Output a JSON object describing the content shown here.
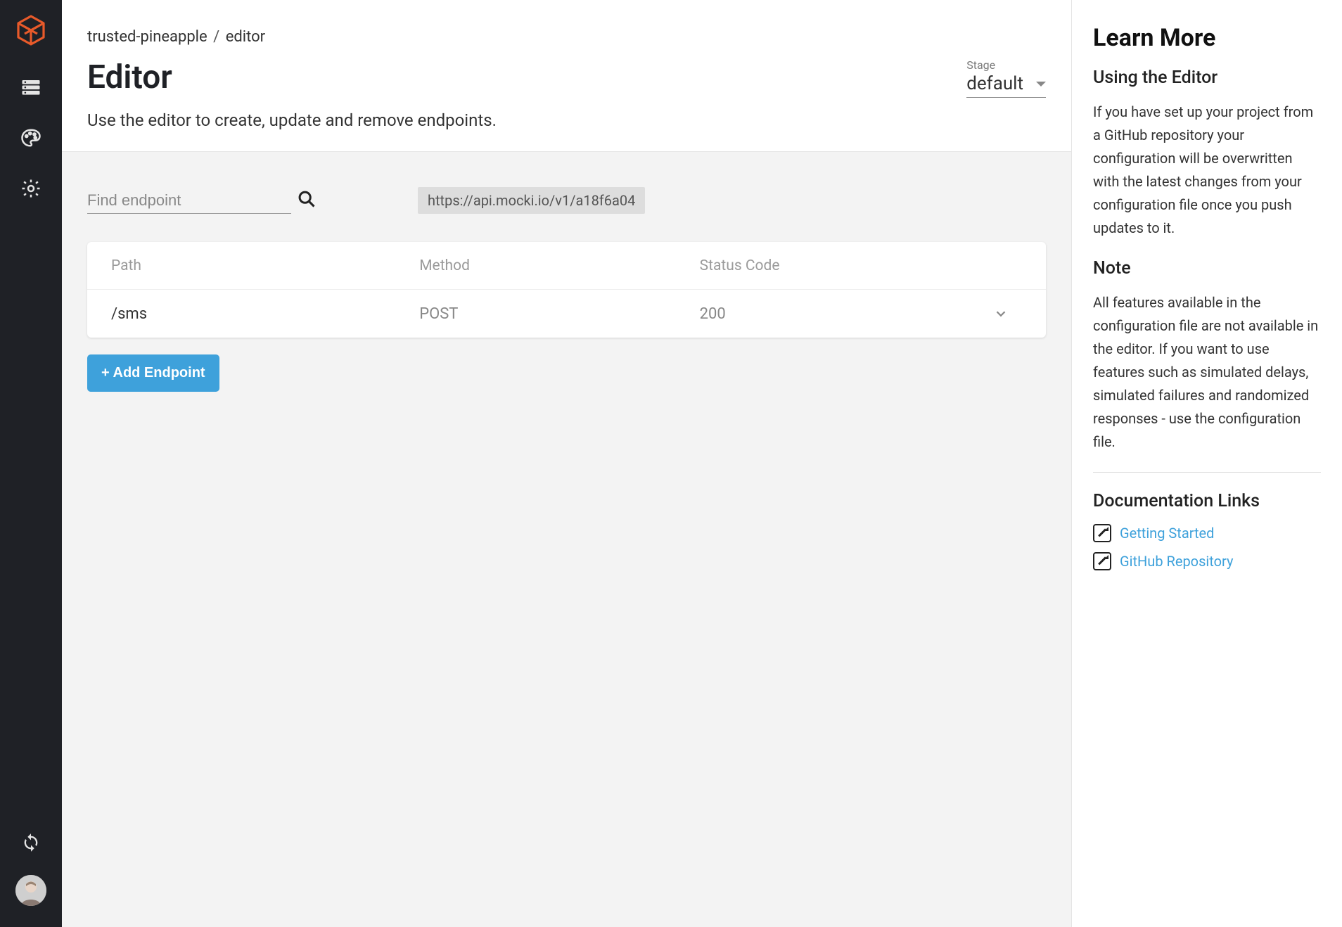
{
  "sidebar": {
    "nav_items": [
      {
        "name": "server-icon"
      },
      {
        "name": "palette-icon"
      },
      {
        "name": "gear-icon"
      }
    ],
    "bottom": {
      "sync_icon": "sync-icon"
    }
  },
  "breadcrumb": {
    "project": "trusted-pineapple",
    "separator": "/",
    "page": "editor"
  },
  "header": {
    "title": "Editor",
    "subtitle": "Use the editor to create, update and remove endpoints.",
    "stage_label": "Stage",
    "stage_value": "default"
  },
  "search": {
    "placeholder": "Find endpoint",
    "api_url": "https://api.mocki.io/v1/a18f6a04"
  },
  "table": {
    "headers": {
      "path": "Path",
      "method": "Method",
      "status": "Status Code"
    },
    "rows": [
      {
        "path": "/sms",
        "method": "POST",
        "status": "200"
      }
    ]
  },
  "buttons": {
    "add_endpoint": "+ Add Endpoint"
  },
  "right_panel": {
    "title": "Learn More",
    "section1_heading": "Using the Editor",
    "section1_body": "If you have set up your project from a GitHub repository your configuration will be overwritten with the latest changes from your configuration file once you push updates to it.",
    "section2_heading": "Note",
    "section2_body": "All features available in the configuration file are not available in the editor. If you want to use features such as simulated delays, simulated failures and randomized responses - use the configuration file.",
    "docs_heading": "Documentation Links",
    "links": [
      {
        "label": "Getting Started"
      },
      {
        "label": "GitHub Repository"
      }
    ]
  }
}
